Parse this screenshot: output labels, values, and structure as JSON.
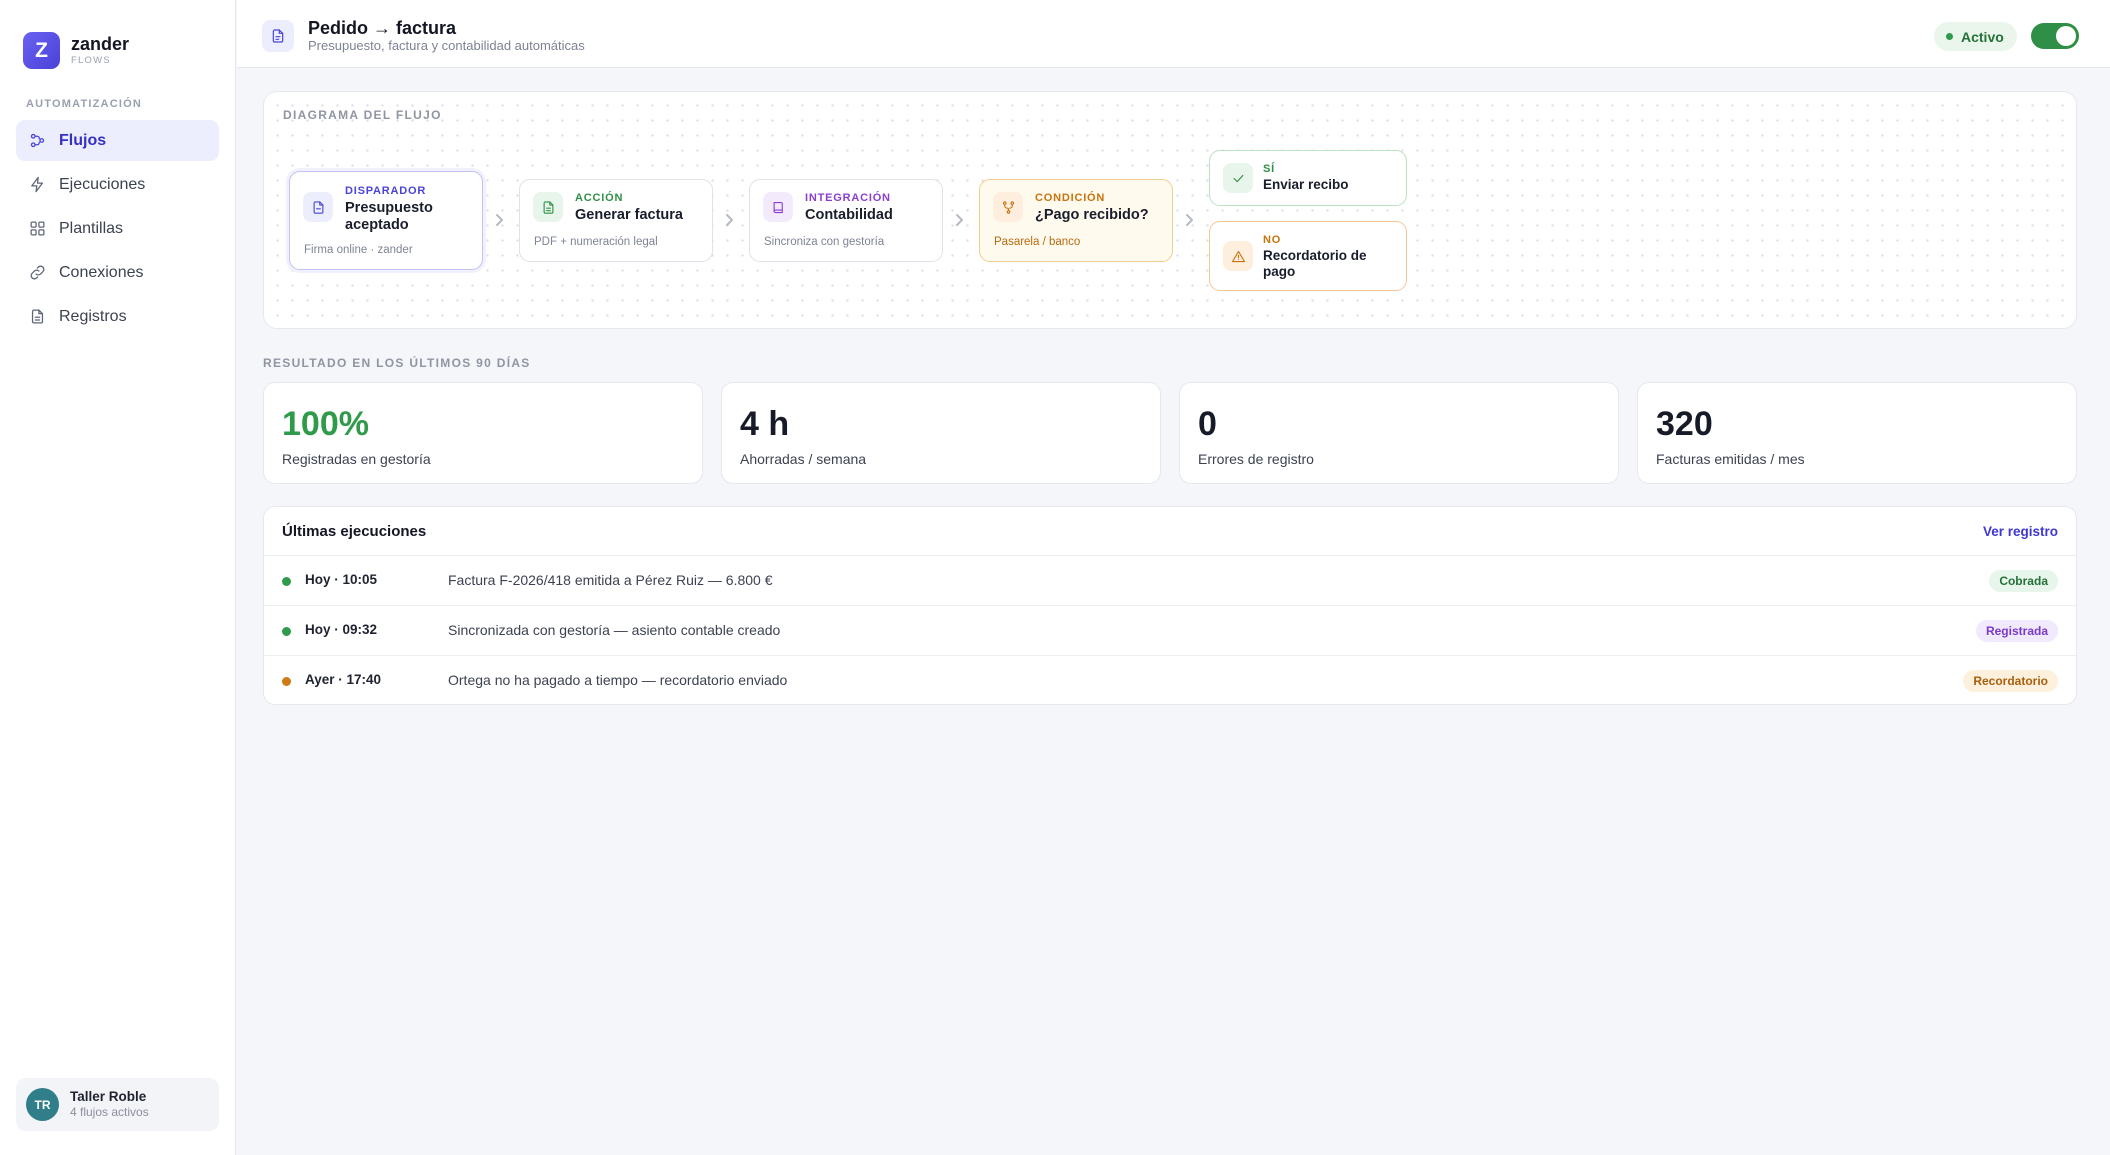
{
  "brand": {
    "initial": "Z",
    "name": "zander",
    "sub": "FLOWS"
  },
  "sidebar": {
    "section": "AUTOMATIZACIÓN",
    "items": [
      {
        "label": "Flujos",
        "icon": "flow-icon",
        "active": true
      },
      {
        "label": "Ejecuciones",
        "icon": "bolt-icon"
      },
      {
        "label": "Plantillas",
        "icon": "grid-icon"
      },
      {
        "label": "Conexiones",
        "icon": "link-icon"
      },
      {
        "label": "Registros",
        "icon": "document-icon"
      }
    ]
  },
  "user": {
    "initials": "TR",
    "name": "Taller Roble",
    "sub": "4 flujos activos"
  },
  "header": {
    "title": "Pedido → factura",
    "subtitle": "Presupuesto, factura y contabilidad automáticas",
    "status": "Activo",
    "toggle_on": true
  },
  "diagram": {
    "label": "DIAGRAMA DEL FLUJO",
    "nodes": [
      {
        "kind": "DISPARADOR",
        "title": "Presupuesto aceptado",
        "note": "Firma online · zander",
        "icon": "document-icon",
        "color": "#4b44d6"
      },
      {
        "kind": "ACCIÓN",
        "title": "Generar factura",
        "note": "PDF + numeración legal",
        "icon": "invoice-icon",
        "color": "#2f8f46"
      },
      {
        "kind": "INTEGRACIÓN",
        "title": "Contabilidad",
        "note": "Sincroniza con gestoría",
        "icon": "book-icon",
        "color": "#8a3fd1"
      },
      {
        "kind": "CONDICIÓN",
        "title": "¿Pago recibido?",
        "note": "Pasarela / banco",
        "icon": "branch-icon",
        "color": "#c9730f"
      }
    ],
    "branches": [
      {
        "kind": "SÍ",
        "title": "Enviar recibo",
        "icon": "check-icon",
        "color": "#2f8f46"
      },
      {
        "kind": "NO",
        "title": "Recordatorio de pago",
        "icon": "warning-icon",
        "color": "#c9730f"
      }
    ]
  },
  "results": {
    "label": "RESULTADO EN LOS ÚLTIMOS 90 DÍAS",
    "stats": [
      {
        "value": "100%",
        "label": "Registradas en gestoría",
        "color": "#2f9a4a"
      },
      {
        "value": "4 h",
        "label": "Ahorradas / semana",
        "color": "#171a27"
      },
      {
        "value": "0",
        "label": "Errores de registro",
        "color": "#171a27"
      },
      {
        "value": "320",
        "label": "Facturas emitidas / mes",
        "color": "#171a27"
      }
    ]
  },
  "runs": {
    "title": "Últimas ejecuciones",
    "link": "Ver registro",
    "rows": [
      {
        "time": "Hoy · 10:05",
        "desc": "Factura F-2026/418 emitida a Pérez Ruiz — 6.800 €",
        "badge": "Cobrada",
        "dot": "#2f9a4a"
      },
      {
        "time": "Hoy · 09:32",
        "desc": "Sincronizada con gestoría — asiento contable creado",
        "badge": "Registrada",
        "dot": "#2f9a4a"
      },
      {
        "time": "Ayer · 17:40",
        "desc": "Ortega no ha pagado a tiempo — recordatorio enviado",
        "badge": "Recordatorio",
        "dot": "#d07a16"
      }
    ]
  }
}
